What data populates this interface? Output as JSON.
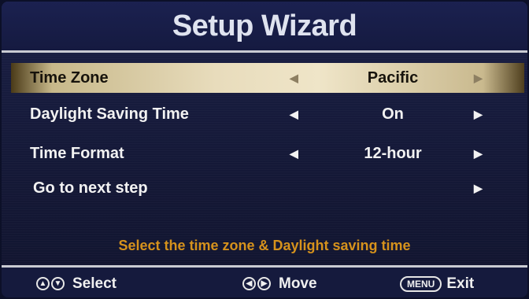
{
  "header": {
    "title": "Setup Wizard"
  },
  "menu": {
    "rows": [
      {
        "label": "Time Zone",
        "value": "Pacific",
        "selected": true
      },
      {
        "label": "Daylight Saving Time",
        "value": "On",
        "selected": false
      },
      {
        "label": "Time Format",
        "value": "12-hour",
        "selected": false
      },
      {
        "label": "Go to next step",
        "value": "",
        "selected": false
      }
    ]
  },
  "hint": "Select the time zone & Daylight saving time",
  "footer": {
    "select_label": "Select",
    "move_label": "Move",
    "menu_button": "MENU",
    "exit_label": "Exit"
  },
  "colors": {
    "background": "#141836",
    "hint_text": "#d6921c",
    "selected_row": "#e8dcbc"
  },
  "icons": {
    "left": "triangle-left-icon",
    "right": "triangle-right-icon",
    "up": "up-arrow-circle-icon",
    "down": "down-arrow-circle-icon"
  }
}
